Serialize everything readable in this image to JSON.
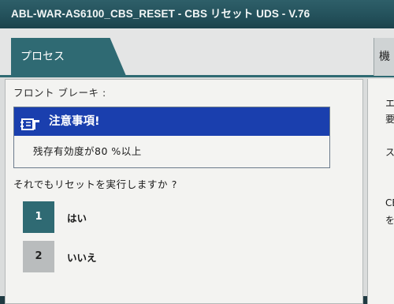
{
  "window": {
    "title": "ABL-WAR-AS6100_CBS_RESET - CBS リセット UDS - V.76"
  },
  "tabs": {
    "active_label": "プロセス",
    "right_label": "機"
  },
  "main": {
    "section_label": "フロント ブレーキ :",
    "notice": {
      "icon": "notebook-icon",
      "title": "注意事項!",
      "message": "残存有効度が80 %以上"
    },
    "question": "それでもリセットを実行しますか ?",
    "options": [
      {
        "number": "1",
        "label": "はい"
      },
      {
        "number": "2",
        "label": "いいえ"
      }
    ]
  },
  "right_panel": {
    "lines": [
      "エ",
      "要",
      "ス",
      "CE",
      "を"
    ]
  },
  "colors": {
    "title_bar": "#23505a",
    "accent_teal": "#2f6a73",
    "notice_blue": "#1a3fae",
    "panel_bg": "#f3f3f1"
  }
}
